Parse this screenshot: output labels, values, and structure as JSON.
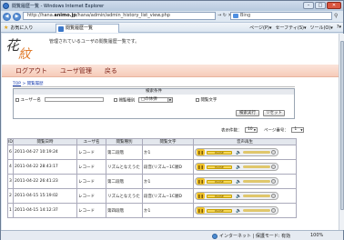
{
  "window": {
    "title": "閲覧履歴一覧 - Windows Internet Explorer",
    "controls": {
      "minimize": "–",
      "maximize": "□",
      "close": "✕"
    }
  },
  "address": {
    "url_prefix": "http://hana.",
    "url_host": "animo.jp",
    "url_rest": "/hana/admin/admin_history_list_view.php",
    "search_placeholder": "Bing",
    "go_glyph": "→",
    "refresh_glyph": "↻",
    "stop_glyph": "✕",
    "search_glyph": "⚲"
  },
  "favorites": {
    "label": "お気に入り",
    "tab_title": "閲覧履歴一覧",
    "commands": [
      "ページ(P)▾",
      "セーフティ(S)▾",
      "ツール(O)▾",
      "?▾"
    ]
  },
  "page": {
    "logo_text_1": "花",
    "logo_text_2": "紋",
    "subtitle": "管理されているユーザの閲覧履歴一覧です。",
    "menu": [
      "ログアウト",
      "ユーザ管理",
      "戻る"
    ],
    "breadcrumb_top": "TOP",
    "breadcrumb_sep": " > ",
    "breadcrumb_current": "閲覧履歴"
  },
  "search": {
    "title": "検索条件",
    "user_label": "ユーザー名",
    "kind_label": "閲覧種別",
    "kind_value": "□の休弾",
    "text_label": "閲覧文字",
    "submit_label": "検索実行",
    "reset_label": "リセット"
  },
  "paging": {
    "per_page_label": "表示件数：",
    "per_page_value": "10",
    "page_label": "ページ番号：",
    "page_value": "1"
  },
  "table": {
    "headers": [
      "ID",
      "閲覧日時",
      "ユーザ名",
      "閲覧種別",
      "閲覧文字",
      "音声再生"
    ],
    "rows": [
      {
        "id": "6",
        "datetime": "2011-04-27 10:19:24",
        "user": "レコード",
        "kind": "第二段階",
        "text": "か1"
      },
      {
        "id": "4",
        "datetime": "2011-04-22 28:43:17",
        "user": "レコード",
        "kind": "リズムとなえうた",
        "text": "段音(リズム−1C順D"
      },
      {
        "id": "3",
        "datetime": "2011-04-22 26:41:23",
        "user": "レコード",
        "kind": "第二段階",
        "text": "か1"
      },
      {
        "id": "2",
        "datetime": "2011-04-15 15:19:02",
        "user": "レコード",
        "kind": "リズムとなえうた",
        "text": "段音(リズム−1C順D"
      },
      {
        "id": "1",
        "datetime": "2011-04-15 14:12:37",
        "user": "レコード",
        "kind": "第四段階",
        "text": "か1"
      }
    ],
    "player": {
      "pause_glyph": "❚❚",
      "track_label": "PAUSE",
      "volume_glyph": "🔈",
      "progress": 0.0
    }
  },
  "status": {
    "zone": "インターネット | 保護モード: 有効",
    "zoom": "100%"
  },
  "colors": {
    "accent": "#e07a2a",
    "menu_text": "#7a1d12",
    "link": "#1a3fb0"
  }
}
